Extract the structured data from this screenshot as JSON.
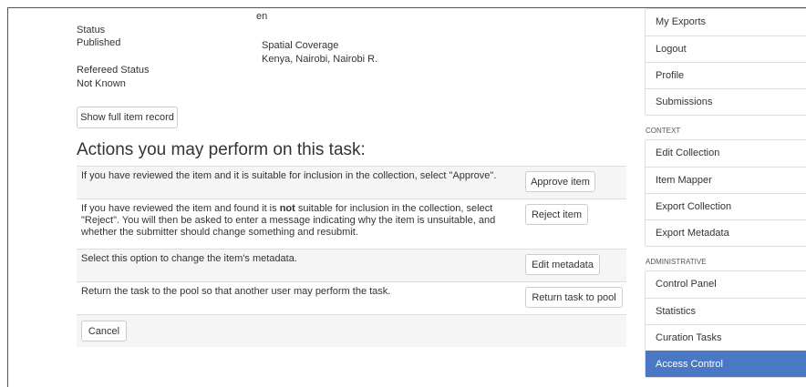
{
  "item_metadata": {
    "language_value": "en",
    "status_label": "Status",
    "status_value": "Published",
    "refereed_label": "Refereed Status",
    "refereed_value": "Not Known",
    "spatial_label": "Spatial Coverage",
    "spatial_value": "Kenya, Nairobi, Nairobi R.",
    "show_full_record_label": "Show full item record"
  },
  "actions": {
    "heading": "Actions you may perform on this task:",
    "approve": {
      "description": "If you have reviewed the item and it is suitable for inclusion in the collection, select \"Approve\".",
      "button_label": "Approve item"
    },
    "reject": {
      "description_before": "If you have reviewed the item and found it is ",
      "description_emphasis": "not",
      "description_after": " suitable for inclusion in the collection, select \"Reject\". You will then be asked to enter a message indicating why the item is unsuitable, and whether the submitter should change something and resubmit.",
      "button_label": "Reject item"
    },
    "edit": {
      "description": "Select this option to change the item's metadata.",
      "button_label": "Edit metadata"
    },
    "return_task": {
      "description": "Return the task to the pool so that another user may perform the task.",
      "button_label": "Return task to pool"
    },
    "cancel_label": "Cancel"
  },
  "sidebar": {
    "account_items": [
      {
        "label": "My Exports"
      },
      {
        "label": "Logout"
      },
      {
        "label": "Profile"
      },
      {
        "label": "Submissions"
      }
    ],
    "context_header": "CONTEXT",
    "context_items": [
      {
        "label": "Edit Collection"
      },
      {
        "label": "Item Mapper"
      },
      {
        "label": "Export Collection"
      },
      {
        "label": "Export Metadata"
      }
    ],
    "admin_header": "ADMINISTRATIVE",
    "admin_items": [
      {
        "label": "Control Panel",
        "active": false
      },
      {
        "label": "Statistics",
        "active": false
      },
      {
        "label": "Curation Tasks",
        "active": false
      },
      {
        "label": "Access Control",
        "active": true
      }
    ]
  },
  "colors": {
    "active_item": "#4a78c4",
    "row_shade": "#f5f5f5",
    "border": "#dddddd"
  }
}
